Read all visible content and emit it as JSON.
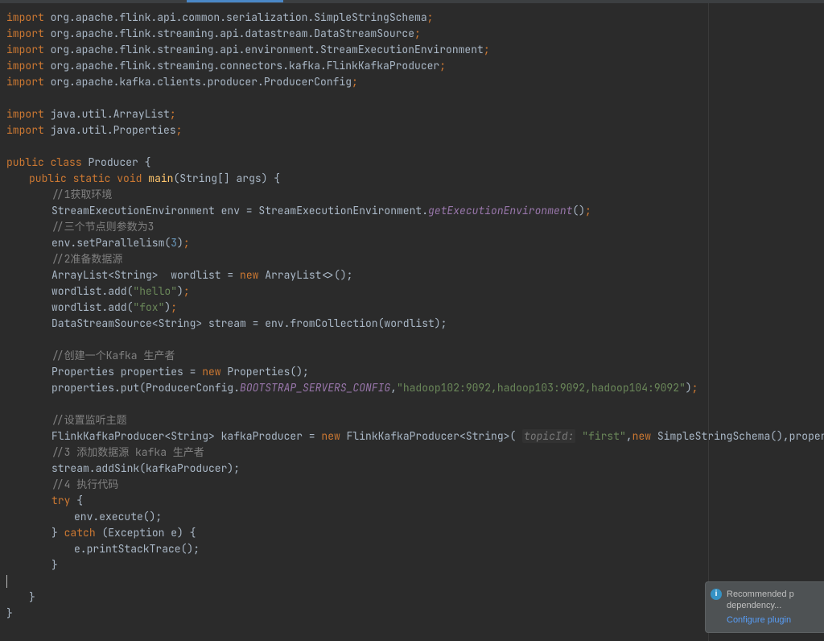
{
  "imports": [
    "org.apache.flink.api.common.serialization.SimpleStringSchema",
    "org.apache.flink.streaming.api.datastream.DataStreamSource",
    "org.apache.flink.streaming.api.environment.StreamExecutionEnvironment",
    "org.apache.flink.streaming.connectors.kafka.FlinkKafkaProducer",
    "org.apache.kafka.clients.producer.ProducerConfig"
  ],
  "imports2": [
    "java.util.ArrayList",
    "java.util.Properties"
  ],
  "kw": {
    "import": "import",
    "public": "public",
    "class": "class",
    "static": "static",
    "void": "void",
    "new": "new",
    "try": "try",
    "catch": "catch"
  },
  "classDecl": "Producer",
  "mainSig": {
    "method": "main",
    "params": "String[] args"
  },
  "c1": "//1获取环境",
  "l1a": "StreamExecutionEnvironment env = StreamExecutionEnvironment.",
  "l1b": "getExecutionEnvironment",
  "c2": "//三个节点则参数为3",
  "l2a": "env.setParallelism(",
  "l2n": "3",
  "c3": "//2准备数据源",
  "l3": "ArrayList<String>  wordlist = ",
  "l3b": " ArrayList<>();",
  "l4a": "wordlist.add(",
  "l4s": "\"hello\"",
  "l5s": "\"fox\"",
  "l6": "DataStreamSource<String> stream = env.fromCollection(wordlist);",
  "c4": "//创建一个Kafka 生产者",
  "l7": "Properties properties = ",
  "l7b": " Properties();",
  "l8a": "properties.put(ProducerConfig.",
  "l8const": "BOOTSTRAP_SERVERS_CONFIG",
  "l8s": "\"hadoop102:9092,hadoop103:9092,hadoop104:9092\"",
  "c5": "//设置监听主题",
  "l9a": "FlinkKafkaProducer<String> kafkaProducer = ",
  "l9b": " FlinkKafkaProducer<String>( ",
  "paramhint": "topicId:",
  "l9s": "\"first\"",
  "l9c": " SimpleStringSchema(),properties);",
  "c6": "//3 添加数据源 kafka 生产者",
  "l10": "stream.addSink(kafkaProducer);",
  "c7": "//4 执行代码",
  "l11": "env.execute();",
  "l12": "(Exception e) {",
  "l13": "e.printStackTrace();",
  "notif": {
    "line1": "Recommended p",
    "line2": "dependency...",
    "link": "Configure plugin"
  }
}
